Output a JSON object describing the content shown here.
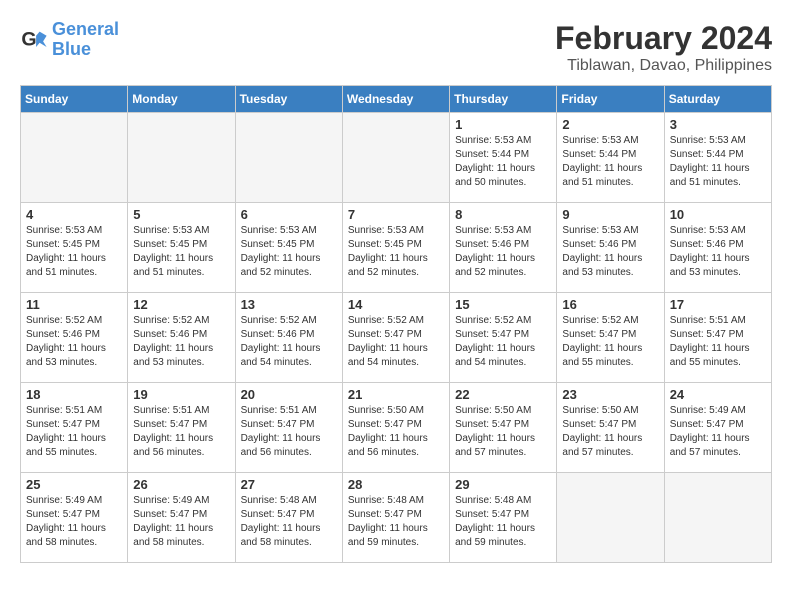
{
  "logo": {
    "text_general": "General",
    "text_blue": "Blue"
  },
  "header": {
    "month_year": "February 2024",
    "location": "Tiblawan, Davao, Philippines"
  },
  "weekdays": [
    "Sunday",
    "Monday",
    "Tuesday",
    "Wednesday",
    "Thursday",
    "Friday",
    "Saturday"
  ],
  "weeks": [
    [
      {
        "day": "",
        "empty": true
      },
      {
        "day": "",
        "empty": true
      },
      {
        "day": "",
        "empty": true
      },
      {
        "day": "",
        "empty": true
      },
      {
        "day": "1",
        "sunrise": "5:53 AM",
        "sunset": "5:44 PM",
        "daylight": "11 hours and 50 minutes."
      },
      {
        "day": "2",
        "sunrise": "5:53 AM",
        "sunset": "5:44 PM",
        "daylight": "11 hours and 51 minutes."
      },
      {
        "day": "3",
        "sunrise": "5:53 AM",
        "sunset": "5:44 PM",
        "daylight": "11 hours and 51 minutes."
      }
    ],
    [
      {
        "day": "4",
        "sunrise": "5:53 AM",
        "sunset": "5:45 PM",
        "daylight": "11 hours and 51 minutes."
      },
      {
        "day": "5",
        "sunrise": "5:53 AM",
        "sunset": "5:45 PM",
        "daylight": "11 hours and 51 minutes."
      },
      {
        "day": "6",
        "sunrise": "5:53 AM",
        "sunset": "5:45 PM",
        "daylight": "11 hours and 52 minutes."
      },
      {
        "day": "7",
        "sunrise": "5:53 AM",
        "sunset": "5:45 PM",
        "daylight": "11 hours and 52 minutes."
      },
      {
        "day": "8",
        "sunrise": "5:53 AM",
        "sunset": "5:46 PM",
        "daylight": "11 hours and 52 minutes."
      },
      {
        "day": "9",
        "sunrise": "5:53 AM",
        "sunset": "5:46 PM",
        "daylight": "11 hours and 53 minutes."
      },
      {
        "day": "10",
        "sunrise": "5:53 AM",
        "sunset": "5:46 PM",
        "daylight": "11 hours and 53 minutes."
      }
    ],
    [
      {
        "day": "11",
        "sunrise": "5:52 AM",
        "sunset": "5:46 PM",
        "daylight": "11 hours and 53 minutes."
      },
      {
        "day": "12",
        "sunrise": "5:52 AM",
        "sunset": "5:46 PM",
        "daylight": "11 hours and 53 minutes."
      },
      {
        "day": "13",
        "sunrise": "5:52 AM",
        "sunset": "5:46 PM",
        "daylight": "11 hours and 54 minutes."
      },
      {
        "day": "14",
        "sunrise": "5:52 AM",
        "sunset": "5:47 PM",
        "daylight": "11 hours and 54 minutes."
      },
      {
        "day": "15",
        "sunrise": "5:52 AM",
        "sunset": "5:47 PM",
        "daylight": "11 hours and 54 minutes."
      },
      {
        "day": "16",
        "sunrise": "5:52 AM",
        "sunset": "5:47 PM",
        "daylight": "11 hours and 55 minutes."
      },
      {
        "day": "17",
        "sunrise": "5:51 AM",
        "sunset": "5:47 PM",
        "daylight": "11 hours and 55 minutes."
      }
    ],
    [
      {
        "day": "18",
        "sunrise": "5:51 AM",
        "sunset": "5:47 PM",
        "daylight": "11 hours and 55 minutes."
      },
      {
        "day": "19",
        "sunrise": "5:51 AM",
        "sunset": "5:47 PM",
        "daylight": "11 hours and 56 minutes."
      },
      {
        "day": "20",
        "sunrise": "5:51 AM",
        "sunset": "5:47 PM",
        "daylight": "11 hours and 56 minutes."
      },
      {
        "day": "21",
        "sunrise": "5:50 AM",
        "sunset": "5:47 PM",
        "daylight": "11 hours and 56 minutes."
      },
      {
        "day": "22",
        "sunrise": "5:50 AM",
        "sunset": "5:47 PM",
        "daylight": "11 hours and 57 minutes."
      },
      {
        "day": "23",
        "sunrise": "5:50 AM",
        "sunset": "5:47 PM",
        "daylight": "11 hours and 57 minutes."
      },
      {
        "day": "24",
        "sunrise": "5:49 AM",
        "sunset": "5:47 PM",
        "daylight": "11 hours and 57 minutes."
      }
    ],
    [
      {
        "day": "25",
        "sunrise": "5:49 AM",
        "sunset": "5:47 PM",
        "daylight": "11 hours and 58 minutes."
      },
      {
        "day": "26",
        "sunrise": "5:49 AM",
        "sunset": "5:47 PM",
        "daylight": "11 hours and 58 minutes."
      },
      {
        "day": "27",
        "sunrise": "5:48 AM",
        "sunset": "5:47 PM",
        "daylight": "11 hours and 58 minutes."
      },
      {
        "day": "28",
        "sunrise": "5:48 AM",
        "sunset": "5:47 PM",
        "daylight": "11 hours and 59 minutes."
      },
      {
        "day": "29",
        "sunrise": "5:48 AM",
        "sunset": "5:47 PM",
        "daylight": "11 hours and 59 minutes."
      },
      {
        "day": "",
        "empty": true
      },
      {
        "day": "",
        "empty": true
      }
    ]
  ]
}
